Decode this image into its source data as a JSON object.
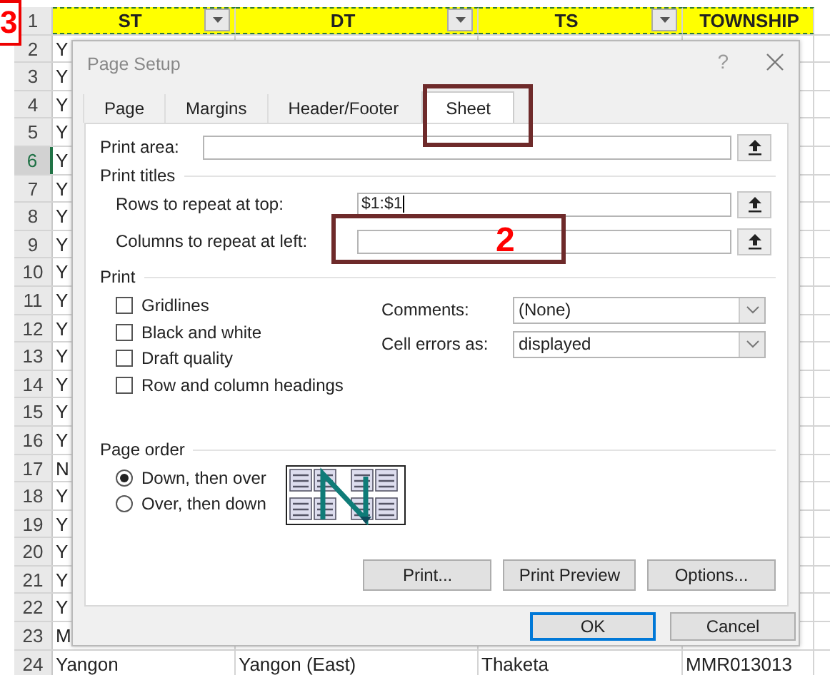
{
  "sheet": {
    "header_row": {
      "number": "1",
      "columns": [
        {
          "label": "ST"
        },
        {
          "label": "DT"
        },
        {
          "label": "TS"
        },
        {
          "label": "TOWNSHIP"
        }
      ]
    },
    "rows": [
      {
        "number": "2",
        "selected": false,
        "cells": [
          "Y"
        ]
      },
      {
        "number": "3",
        "selected": false,
        "cells": [
          "Y"
        ]
      },
      {
        "number": "4",
        "selected": false,
        "cells": [
          "Y"
        ]
      },
      {
        "number": "5",
        "selected": false,
        "cells": [
          "Y"
        ]
      },
      {
        "number": "6",
        "selected": true,
        "cells": [
          "Y"
        ]
      },
      {
        "number": "7",
        "selected": false,
        "cells": [
          "Y"
        ]
      },
      {
        "number": "8",
        "selected": false,
        "cells": [
          "Y"
        ]
      },
      {
        "number": "9",
        "selected": false,
        "cells": [
          "Y"
        ]
      },
      {
        "number": "10",
        "selected": false,
        "cells": [
          "Y"
        ]
      },
      {
        "number": "11",
        "selected": false,
        "cells": [
          "Y"
        ]
      },
      {
        "number": "12",
        "selected": false,
        "cells": [
          "Y"
        ]
      },
      {
        "number": "13",
        "selected": false,
        "cells": [
          "Y"
        ]
      },
      {
        "number": "14",
        "selected": false,
        "cells": [
          "Y"
        ]
      },
      {
        "number": "15",
        "selected": false,
        "cells": [
          "Y"
        ]
      },
      {
        "number": "16",
        "selected": false,
        "cells": [
          "Y"
        ]
      },
      {
        "number": "17",
        "selected": false,
        "cells": [
          "N"
        ]
      },
      {
        "number": "18",
        "selected": false,
        "cells": [
          "Y"
        ]
      },
      {
        "number": "19",
        "selected": false,
        "cells": [
          "Y"
        ]
      },
      {
        "number": "20",
        "selected": false,
        "cells": [
          "Y"
        ]
      },
      {
        "number": "21",
        "selected": false,
        "cells": [
          "Y"
        ]
      },
      {
        "number": "22",
        "selected": false,
        "cells": [
          "Y"
        ]
      },
      {
        "number": "23",
        "selected": false,
        "cells": [
          "M"
        ]
      },
      {
        "number": "24",
        "selected": false,
        "cells": [
          "Yangon",
          "Yangon (East)",
          "Thaketa",
          "MMR013013"
        ]
      }
    ]
  },
  "callouts": [
    {
      "number": "3"
    },
    {
      "number": "2"
    }
  ],
  "dialog": {
    "title": "Page Setup",
    "help": "?",
    "tabs": [
      {
        "label": "Page",
        "selected": false
      },
      {
        "label": "Margins",
        "selected": false
      },
      {
        "label": "Header/Footer",
        "selected": false
      },
      {
        "label": "Sheet",
        "selected": true
      }
    ],
    "print_area": {
      "label": "Print area:"
    },
    "print_titles": {
      "heading": "Print titles",
      "rows_label": "Rows to repeat at top:",
      "rows_value": "$1:$1",
      "columns_label": "Columns to repeat at left:"
    },
    "print": {
      "heading": "Print",
      "options": [
        {
          "label": "Gridlines",
          "checked": false
        },
        {
          "label": "Black and white",
          "checked": false
        },
        {
          "label": "Draft quality",
          "checked": false
        },
        {
          "label": "Row and column headings",
          "checked": false
        }
      ],
      "selects": [
        {
          "label": "Comments:",
          "value": "(None)"
        },
        {
          "label": "Cell errors as:",
          "value": "displayed"
        }
      ]
    },
    "page_order": {
      "heading": "Page order",
      "options": [
        {
          "label": "Down, then over",
          "selected": true
        },
        {
          "label": "Over, then down",
          "selected": false
        }
      ]
    },
    "panel_buttons": [
      "Print...",
      "Print Preview",
      "Options..."
    ],
    "footer_buttons": [
      {
        "label": "OK",
        "default": true
      },
      {
        "label": "Cancel",
        "default": false
      }
    ]
  }
}
